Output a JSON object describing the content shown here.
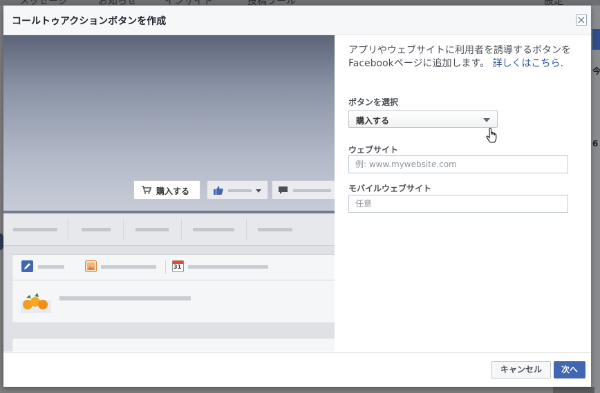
{
  "background": {
    "top_tabs": [
      "メッセージ",
      "お知らせ",
      "インサイト",
      "投稿ツール",
      "設定"
    ],
    "right_snippets": [
      "今",
      "6"
    ]
  },
  "dialog": {
    "title": "コールトゥアクションボタンを作成",
    "close_label": "閉じる"
  },
  "preview": {
    "cta_button_label": "購入する",
    "composer_calendar_day": "31"
  },
  "form": {
    "intro_text": "アプリやウェブサイトに利用者を誘導するボタンをFacebookページに追加します。",
    "learn_more_link": "詳しくはこちら.",
    "select_button": {
      "label": "ボタンを選択",
      "value": "購入する"
    },
    "website": {
      "label": "ウェブサイト",
      "placeholder": "例: www.mywebsite.com",
      "value": ""
    },
    "mobile_website": {
      "label": "モバイルウェブサイト",
      "placeholder": "任意",
      "value": ""
    }
  },
  "footer": {
    "cancel_label": "キャンセル",
    "next_label": "次へ"
  },
  "colors": {
    "primary": "#4267b2",
    "link": "#365899",
    "header_bg": "#f6f7f9"
  }
}
